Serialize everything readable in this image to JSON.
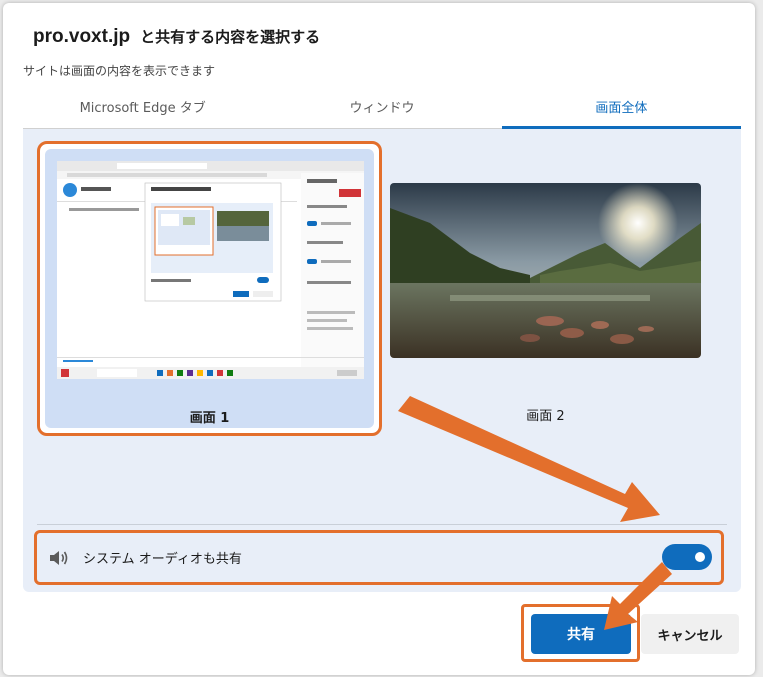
{
  "dialog": {
    "site": "pro.voxt.jp",
    "title_rest": "と共有する内容を選択する",
    "subtitle": "サイトは画面の内容を表示できます"
  },
  "tabs": [
    {
      "label": "Microsoft Edge タブ",
      "active": false
    },
    {
      "label": "ウィンドウ",
      "active": false
    },
    {
      "label": "画面全体",
      "active": true
    }
  ],
  "screens": [
    {
      "label": "画面 1",
      "selected": true
    },
    {
      "label": "画面 2",
      "selected": false
    }
  ],
  "audio": {
    "label": "システム オーディオも共有",
    "enabled": true,
    "icon": "speaker-icon"
  },
  "buttons": {
    "share": "共有",
    "cancel": "キャンセル"
  },
  "colors": {
    "accent": "#0f6cbd",
    "highlight": "#e36f2c"
  }
}
